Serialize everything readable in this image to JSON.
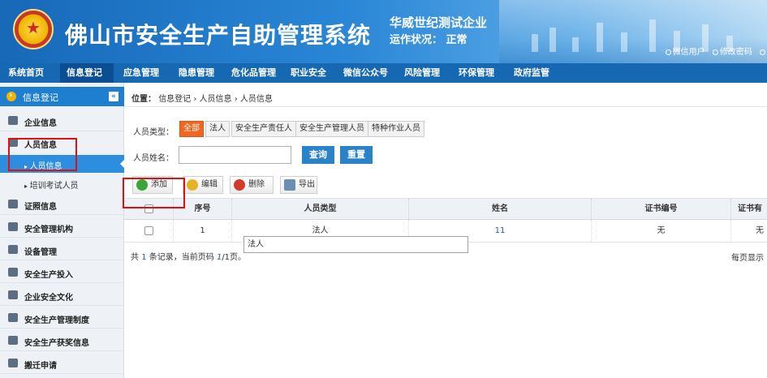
{
  "header": {
    "title": "佛山市安全生产自助管理系统",
    "company": "华威世纪测试企业",
    "status_label": "运作状况：",
    "status_value": "正常",
    "links": [
      "微信用户",
      "修改密码"
    ]
  },
  "nav": {
    "items": [
      "系统首页",
      "信息登记",
      "应急管理",
      "隐患管理",
      "危化品管理",
      "职业安全",
      "微信公众号",
      "风险管理",
      "环保管理",
      "政府监管"
    ],
    "active_index": 1
  },
  "sidebar": {
    "header": "信息登记",
    "items": {
      "company_info": "企业信息",
      "personnel_info": "人员信息",
      "sub_personnel": "人员信息",
      "sub_training": "培训考试人员",
      "certificate": "证照信息",
      "safety_org": "安全管理机构",
      "equipment": "设备管理",
      "investment": "安全生产投入",
      "culture": "企业安全文化",
      "rules": "安全生产管理制度",
      "awards": "安全生产获奖信息",
      "relocation": "搬迁申请"
    }
  },
  "breadcrumb": {
    "label": "位置：",
    "path": "信息登记 › 人员信息 › 人员信息"
  },
  "filter": {
    "type_label": "人员类型：",
    "types": [
      "全部",
      "法人",
      "安全生产责任人",
      "安全生产管理人员",
      "特种作业人员"
    ],
    "active_type_index": 0,
    "name_label": "人员姓名：",
    "name_value": "",
    "search_button": "查询",
    "reset_button": "重置"
  },
  "toolbar": {
    "add": "添加",
    "edit": "编辑",
    "delete": "删除",
    "export": "导出"
  },
  "table": {
    "columns": [
      "序号",
      "人员类型",
      "姓名",
      "证书编号",
      "证书有"
    ],
    "rows": [
      {
        "index": "1",
        "type": "法人",
        "name": "11",
        "cert_no": "无",
        "cert_valid": "无"
      }
    ]
  },
  "tooltip": "法人",
  "footer": {
    "prefix": "共",
    "count": "1",
    "middle": "条记录，当前页码",
    "page": "1",
    "total": "/1",
    "suffix": "页。",
    "page_size_label": "每页显示"
  },
  "colors": {
    "nav_bg": "#1768b3",
    "accent": "#f26522",
    "highlight_box": "#e01010"
  }
}
